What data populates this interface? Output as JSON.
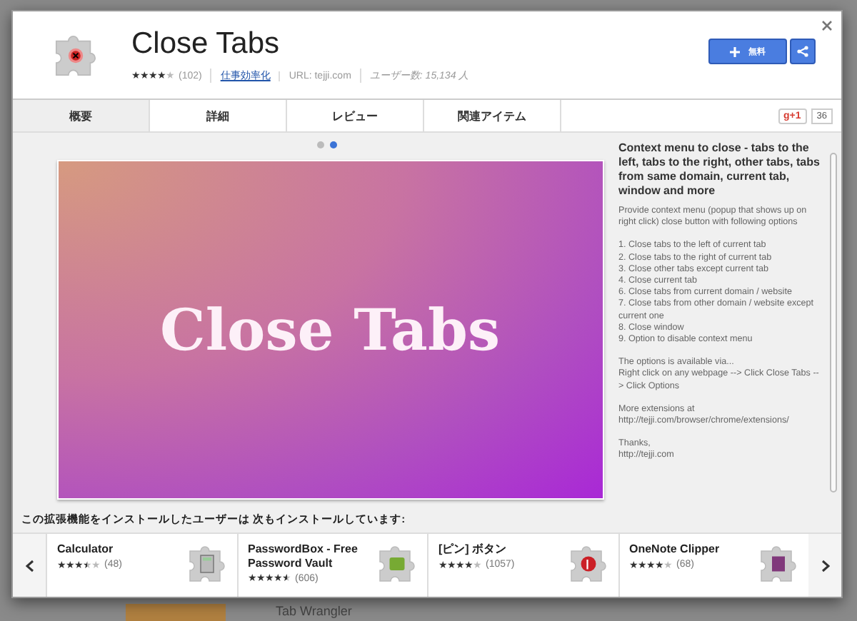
{
  "dialog": {
    "title": "Close Tabs",
    "stars": 4,
    "rating_count": "(102)",
    "category": "仕事効率化",
    "url": "URL: tejji.com",
    "users": "ユーザー数: 15,134 人",
    "add_button": "無料"
  },
  "tabs": [
    {
      "label": "概要",
      "selected": true
    },
    {
      "label": "詳細",
      "selected": false
    },
    {
      "label": "レビュー",
      "selected": false
    },
    {
      "label": "関連アイテム",
      "selected": false
    }
  ],
  "gplus": {
    "label": "g+1",
    "count": "36"
  },
  "slides": [
    {
      "selected": false
    },
    {
      "selected": true
    }
  ],
  "screenshot": {
    "text": "Close Tabs"
  },
  "description": {
    "heading": "Context menu to close - tabs to the left, tabs to the right, other tabs, tabs from same domain, current tab, window and more",
    "paragraphs": [
      [
        "Provide context menu (popup that shows up on right click) close button with following options"
      ],
      [
        "1. Close tabs to the left of current tab",
        "2. Close tabs to the right of current tab",
        "3. Close other tabs except current tab",
        "4. Close current tab",
        "6. Close tabs from current domain / website",
        "7. Close tabs from other domain / website except current one",
        "8. Close window",
        "9. Option to disable context menu"
      ],
      [
        "The options is available via...",
        "Right click on any webpage --> Click Close Tabs --> Click Options"
      ],
      [
        "More extensions at",
        "http://tejji.com/browser/chrome/extensions/"
      ],
      [
        "Thanks,",
        "http://tejji.com"
      ]
    ]
  },
  "related": {
    "heading": "この拡張機能をインストールしたユーザーは 次もインストールしています:",
    "items": [
      {
        "name": "Calculator",
        "stars": 3.5,
        "count": "(48)",
        "kind": "calculator"
      },
      {
        "name": "PasswordBox - Free Password Vault",
        "stars": 4.5,
        "count": "(606)",
        "kind": "vault"
      },
      {
        "name": "[ピン] ボタン",
        "stars": 4,
        "count": "(1057)",
        "kind": "pin"
      },
      {
        "name": "OneNote Clipper",
        "stars": 4,
        "count": "(68)",
        "kind": "note"
      }
    ]
  },
  "background_page": {
    "item_title": "Tab Wrangler"
  }
}
